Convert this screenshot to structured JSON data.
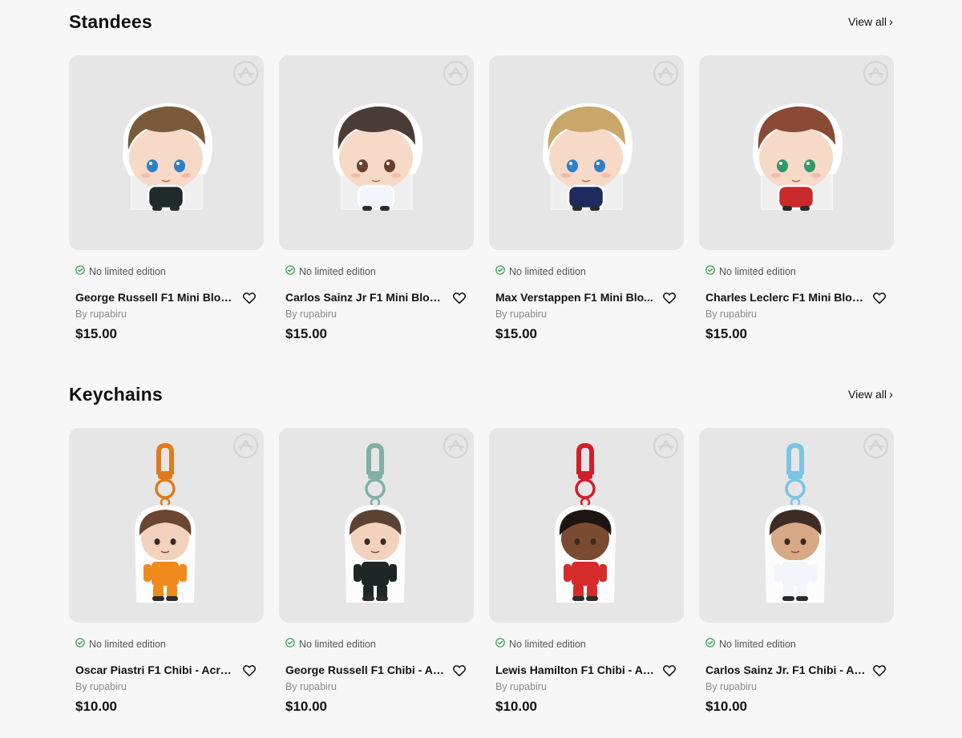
{
  "sections": [
    {
      "title": "Standees",
      "view_all": "View all",
      "products": [
        {
          "name": "George Russell F1 Mini Bloc...",
          "edition": "No limited edition",
          "by": "By rupabiru",
          "price": "$15.00",
          "kind": "standee",
          "hair": "#7a5a3a",
          "eyes": "#2d7fc9",
          "outfit": "#1f2a2a"
        },
        {
          "name": "Carlos Sainz Jr F1 Mini Block...",
          "edition": "No limited edition",
          "by": "By rupabiru",
          "price": "$15.00",
          "kind": "standee",
          "hair": "#4a3d37",
          "eyes": "#6b3f2a",
          "outfit": "#f2f5fb"
        },
        {
          "name": "Max Verstappen F1 Mini Blo...",
          "edition": "No limited edition",
          "by": "By rupabiru",
          "price": "$15.00",
          "kind": "standee",
          "hair": "#c9a76a",
          "eyes": "#2d7fc9",
          "outfit": "#1d2b5e"
        },
        {
          "name": "Charles Leclerc F1 Mini Bloc...",
          "edition": "No limited edition",
          "by": "By rupabiru",
          "price": "$15.00",
          "kind": "standee",
          "hair": "#8a4a35",
          "eyes": "#2f9a6a",
          "outfit": "#c92b2b"
        }
      ]
    },
    {
      "title": "Keychains",
      "view_all": "View all",
      "products": [
        {
          "name": "Oscar Piastri F1 Chibi - Acryl...",
          "edition": "No limited edition",
          "by": "By rupabiru",
          "price": "$10.00",
          "kind": "keychain",
          "hook": "#e07a1c",
          "hair": "#6b4630",
          "skin": "#f3d2bd",
          "outfit": "#ef8a1c"
        },
        {
          "name": "George Russell F1 Chibi - Ac...",
          "edition": "No limited edition",
          "by": "By rupabiru",
          "price": "$10.00",
          "kind": "keychain",
          "hook": "#7fb0a3",
          "hair": "#5b4232",
          "skin": "#f3d2bd",
          "outfit": "#1e2626"
        },
        {
          "name": "Lewis Hamilton F1 Chibi - Ac...",
          "edition": "No limited edition",
          "by": "By rupabiru",
          "price": "$10.00",
          "kind": "keychain",
          "hook": "#d11f2a",
          "hair": "#1d1512",
          "skin": "#7a4b32",
          "outfit": "#d52b2b"
        },
        {
          "name": "Carlos Sainz Jr. F1 Chibi - Ac...",
          "edition": "No limited edition",
          "by": "By rupabiru",
          "price": "$10.00",
          "kind": "keychain",
          "hook": "#7cc3e4",
          "hair": "#3d2c24",
          "skin": "#d8a986",
          "outfit": "#f2f6fb"
        }
      ]
    }
  ],
  "colors": {
    "background": "#f7f7f7",
    "card": "#e6e6e6",
    "check": "#2e9e46"
  }
}
